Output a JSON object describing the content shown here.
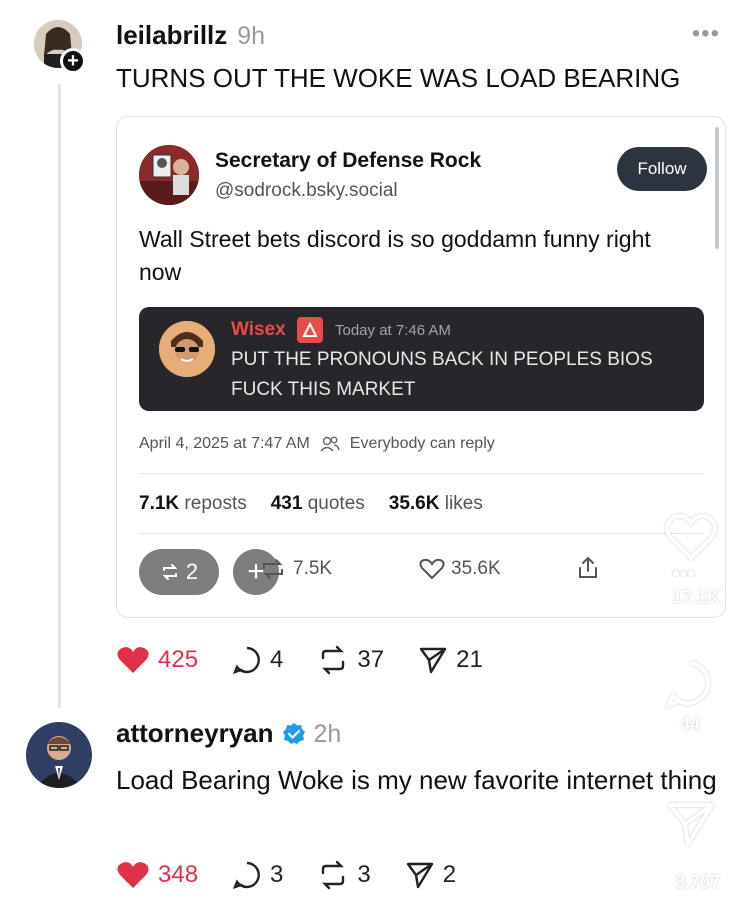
{
  "post1": {
    "username": "leilabrillz",
    "time": "9h",
    "text": "TURNS OUT THE WOKE WAS LOAD BEARING",
    "more": "•••",
    "actions": {
      "likes": "425",
      "comments": "4",
      "reposts": "37",
      "shares": "21"
    }
  },
  "embed": {
    "name": "Secretary of Defense Rock",
    "handle": "@sodrock.bsky.social",
    "follow_label": "Follow",
    "text": "Wall Street bets discord is so goddamn funny right now",
    "discord": {
      "name": "Wisex",
      "time": "Today at 7:46 AM",
      "message": "PUT THE PRONOUNS BACK IN PEOPLES BIOS FUCK THIS MARKET"
    },
    "date": "April 4, 2025 at 7:47 AM",
    "reply_setting": "Everybody can reply",
    "stats": {
      "reposts_num": "7.1K",
      "reposts_label": "reposts",
      "quotes_num": "431",
      "quotes_label": "quotes",
      "likes_num": "35.6K",
      "likes_label": "likes"
    },
    "actions": {
      "pill_count": "2",
      "plus": "+",
      "reposts": "7.5K",
      "likes": "35.6K"
    }
  },
  "post2": {
    "username": "attorneyryan",
    "time": "2h",
    "text": "Load Bearing Woke is my new favorite internet thing",
    "actions": {
      "likes": "348",
      "comments": "3",
      "reposts": "3",
      "shares": "2"
    }
  },
  "overlay": {
    "likes": "17.1K",
    "comments": "44",
    "shares": "3,707",
    "dots": "•••"
  },
  "colors": {
    "like_red": "#e0304a",
    "verified_blue": "#1d9bf0",
    "follow_bg": "#2c3440",
    "discord_bg": "#26262b",
    "discord_name": "#e74c4c"
  }
}
